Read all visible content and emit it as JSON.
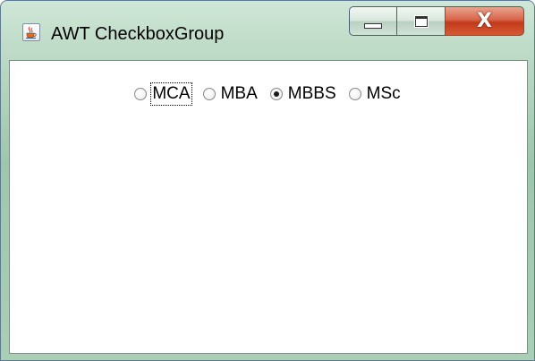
{
  "window": {
    "title": "AWT CheckboxGroup",
    "app_icon": "java-cup-icon",
    "caption_buttons": {
      "minimize": "minimize-icon",
      "maximize": "maximize-icon",
      "close": "close-icon"
    }
  },
  "checkbox_group": {
    "options": [
      {
        "label": "MCA",
        "checked": false,
        "focused": true
      },
      {
        "label": "MBA",
        "checked": false,
        "focused": false
      },
      {
        "label": "MBBS",
        "checked": true,
        "focused": false
      },
      {
        "label": "MSc",
        "checked": false,
        "focused": false
      }
    ],
    "selected": "MBBS"
  }
}
